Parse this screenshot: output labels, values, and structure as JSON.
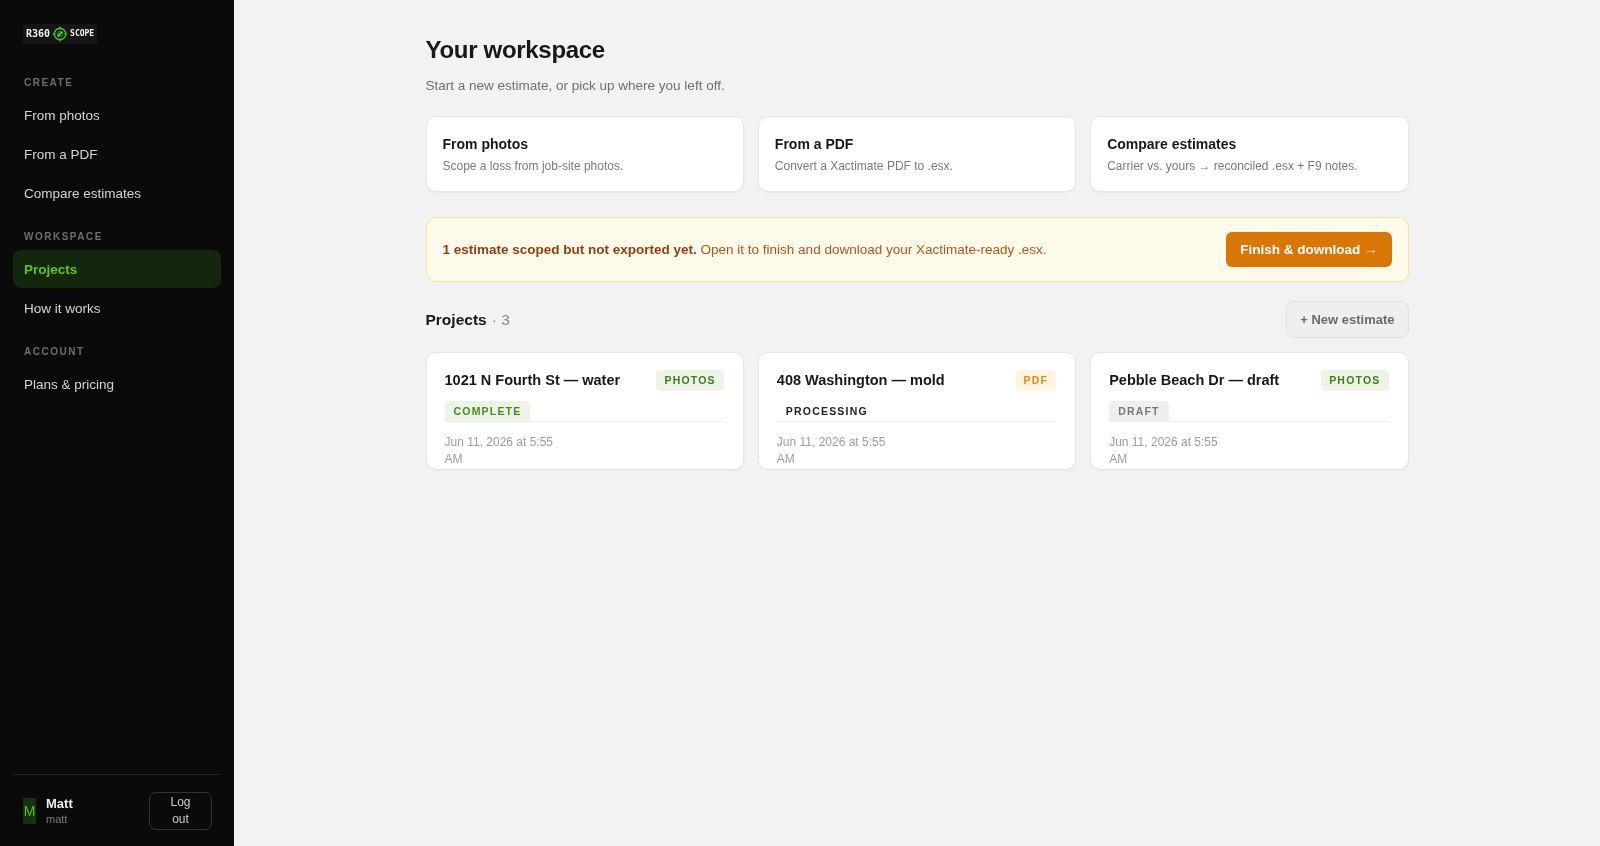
{
  "sidebar": {
    "logo": {
      "text_left": "R360",
      "text_right": "SCOPE"
    },
    "sections": [
      {
        "label": "CREATE",
        "items": [
          {
            "label": "From photos",
            "selected": false
          },
          {
            "label": "From a PDF",
            "selected": false
          },
          {
            "label": "Compare estimates",
            "selected": false
          }
        ]
      },
      {
        "label": "WORKSPACE",
        "items": [
          {
            "label": "Projects",
            "selected": true
          },
          {
            "label": "How it works",
            "selected": false
          }
        ]
      },
      {
        "label": "ACCOUNT",
        "items": [
          {
            "label": "Plans & pricing",
            "selected": false
          }
        ]
      }
    ],
    "user": {
      "avatar": "M",
      "name": "Matt",
      "handle": "matt",
      "logout_button": "Log out"
    }
  },
  "main": {
    "title": "Your workspace",
    "subtitle": "Start a new estimate, or pick up where you left off.",
    "actions": [
      {
        "title": "From photos",
        "description": "Scope a loss from job-site photos."
      },
      {
        "title": "From a PDF",
        "description": "Convert a Xactimate PDF to .esx."
      },
      {
        "title": "Compare estimates",
        "description": "Carrier vs. yours → reconciled .esx + F9 notes."
      }
    ],
    "notice": {
      "text": "**1 estimate scoped but not exported yet.** Open it to finish and download your Xactimate-ready .esx.",
      "button": "Finish & download →"
    },
    "projects": {
      "title": "Projects",
      "count": "· 3",
      "new_button": "+ New estimate",
      "items": [
        {
          "title": "1021 N Fourth St — water",
          "source": {
            "label": "PHOTOS",
            "kind": "photos"
          },
          "status": {
            "label": "COMPLETE",
            "kind": "complete"
          },
          "date": "Jun 11, 2026 at 5:55 AM"
        },
        {
          "title": "408 Washington — mold",
          "source": {
            "label": "PDF",
            "kind": "pdf"
          },
          "status": {
            "label": "PROCESSING",
            "kind": "processing"
          },
          "date": "Jun 11, 2026 at 5:55 AM"
        },
        {
          "title": "Pebble Beach Dr — draft",
          "source": {
            "label": "PHOTOS",
            "kind": "photos"
          },
          "status": {
            "label": "DRAFT",
            "kind": "draft"
          },
          "date": "Jun 11, 2026 at 5:55 AM"
        }
      ]
    }
  }
}
